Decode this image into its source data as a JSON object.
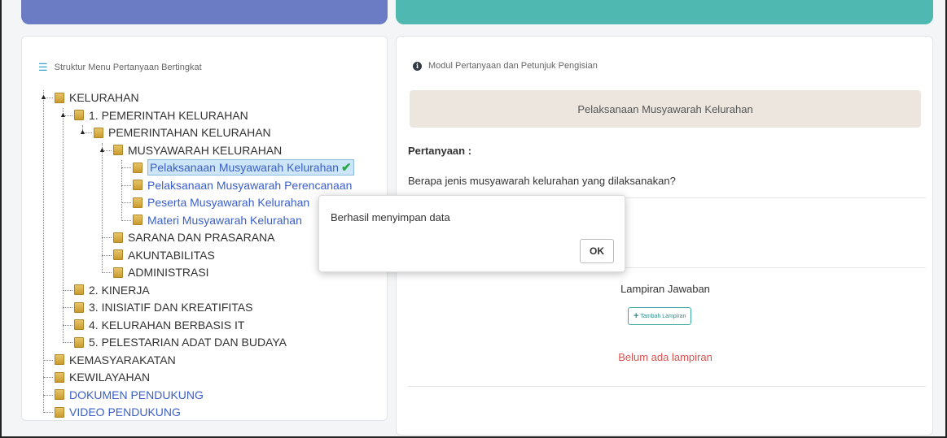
{
  "left_panel": {
    "title": "Struktur Menu Pertanyaan Bertingkat",
    "icon": "list-icon",
    "tree": [
      {
        "label": "KELURAHAN",
        "level": 0
      },
      {
        "label": "1. PEMERINTAH KELURAHAN",
        "level": 1
      },
      {
        "label": "PEMERINTAHAN KELURAHAN",
        "level": 2
      },
      {
        "label": "MUSYAWARAH KELURAHAN",
        "level": 3
      },
      {
        "label": "Pelaksanaan Musyawarah Kelurahan",
        "level": 4,
        "selected": true,
        "link": true
      },
      {
        "label": "Pelaksanaan Musyawarah Perencanaan",
        "level": 4,
        "link": true
      },
      {
        "label": "Peserta Musyawarah Kelurahan",
        "level": 4,
        "link": true
      },
      {
        "label": "Materi Musyawarah Kelurahan",
        "level": 4,
        "link": true
      },
      {
        "label": "SARANA DAN PRASARANA",
        "level": 3
      },
      {
        "label": "AKUNTABILITAS",
        "level": 3
      },
      {
        "label": "ADMINISTRASI",
        "level": 3
      },
      {
        "label": "2. KINERJA",
        "level": 1
      },
      {
        "label": "3. INISIATIF DAN KREATIFITAS",
        "level": 1
      },
      {
        "label": "4. KELURAHAN BERBASIS IT",
        "level": 1
      },
      {
        "label": "5. PELESTARIAN ADAT DAN BUDAYA",
        "level": 1
      },
      {
        "label": "KEMASYARAKATAN",
        "level": 0
      },
      {
        "label": "KEWILAYAHAN",
        "level": 0
      },
      {
        "label": "DOKUMEN PENDUKUNG",
        "level": 0,
        "link": true
      },
      {
        "label": "VIDEO PENDUKUNG",
        "level": 0,
        "link": true
      }
    ]
  },
  "right_panel": {
    "title": "Modul Pertanyaan dan Petunjuk Pengisian",
    "section_title": "Pelaksanaan Musyawarah Kelurahan",
    "question_label": "Pertanyaan :",
    "question_text": "Berapa jenis musyawarah kelurahan yang dilaksanakan?",
    "attachment_label": "Lampiran Jawaban",
    "add_attachment_button": "Tambah Lampiran",
    "no_attachment_text": "Belum ada lampiran"
  },
  "dialog": {
    "message": "Berhasil menyimpan data",
    "ok_label": "OK"
  },
  "colors": {
    "band_left": "#6b7cc5",
    "band_right": "#4fb8b0",
    "link": "#3a5fc8",
    "success": "#2ba84a",
    "danger": "#d9534f"
  }
}
